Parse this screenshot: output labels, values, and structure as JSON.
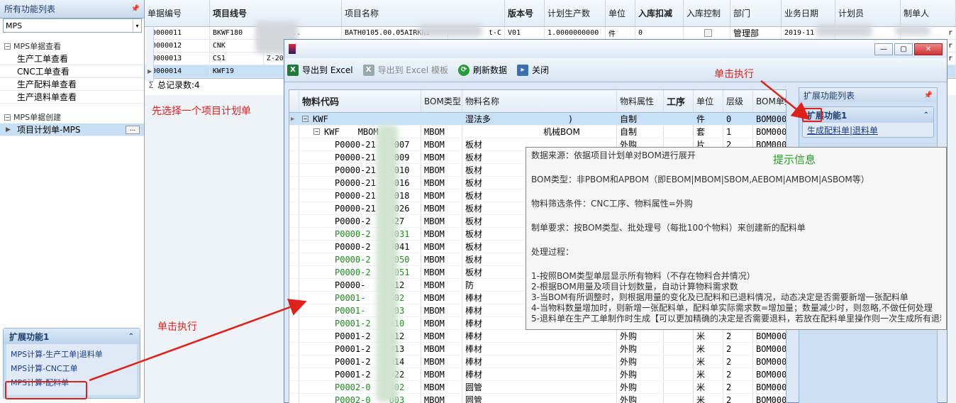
{
  "left_panel": {
    "header": "所有功能列表",
    "pin": "ᵖ",
    "combo_value": "MPS",
    "group1_title": "MPS单据查看",
    "group1_items": [
      "生产工单查看",
      "CNC工单查看",
      "生产配料单查看",
      "生产退料单查看"
    ],
    "group2_title": "MPS单据创建",
    "group2_items": [
      "项目计划单-MPS"
    ],
    "more_btn": "...",
    "ext_title": "扩展功能1",
    "ext_links": [
      "MPS计算-生产工单|退料单",
      "MPS计算-CNC工单",
      "MPS计算-配料单"
    ]
  },
  "grid": {
    "columns": [
      "单据编号",
      "项目线号",
      "项目名称",
      "版本号",
      "计划生产数",
      "单位",
      "入库扣减",
      "入库控制",
      "部门",
      "业务日期",
      "计划员",
      "制单人"
    ],
    "rows": [
      {
        "id": "00000011",
        "line": "BKWF180",
        "name_suffix": "0-05A...",
        "proj": "BATH0105.00.05AIRKNI",
        "proj2": "t-C",
        "ver": "V01",
        "qty": "1.0000000000",
        "unit": "件",
        "deduct": "0",
        "dept": "管理部",
        "date": "2019-11",
        "maker": "r"
      },
      {
        "id": "00000012",
        "line": "CNK",
        "maker": "r"
      },
      {
        "id": "00000013",
        "line": "CS1",
        "name_suffix": "Z-20",
        "maker": "r"
      },
      {
        "id": "00000014",
        "line": "KWF19"
      }
    ],
    "summary_symbol": "Σ",
    "summary": "总记录数:4"
  },
  "dialog": {
    "toolbar": {
      "export": "导出到 Excel",
      "export_template": "导出到 Excel 模板",
      "refresh": "刷新数据",
      "close": "关闭"
    },
    "tree_columns": [
      "物料代码",
      "BOM类型",
      "物料名称",
      "物料属性",
      "工序",
      "单位",
      "层级",
      "BOM单据"
    ],
    "tree_rows": [
      {
        "code": "KWF",
        "bom": "",
        "name": "湿法多",
        "name2": ")",
        "attr": "自制",
        "unit": "件",
        "level": "0",
        "doc": "BOM0000",
        "type": "root"
      },
      {
        "code": "KWF",
        "code2": "MBOM",
        "bom": "MBOM",
        "name": "",
        "name2": "机械BOM",
        "attr": "自制",
        "unit": "套",
        "level": "1",
        "doc": "BOM0000",
        "type": "sub"
      },
      {
        "code": "P0000-21",
        "code2": "007",
        "bom": "MBOM",
        "name": "板材",
        "attr": "外购",
        "unit": "片",
        "level": "2",
        "doc": "BOM000",
        "type": "leaf"
      },
      {
        "code": "P0000-21",
        "code2": "009",
        "bom": "MBOM",
        "name": "板材",
        "type": "leaf"
      },
      {
        "code": "P0000-21",
        "code2": "010",
        "bom": "MBOM",
        "name": "板材",
        "type": "leaf"
      },
      {
        "code": "P0000-21",
        "code2": "016",
        "bom": "MBOM",
        "name": "板材",
        "type": "leaf"
      },
      {
        "code": "P0000-21",
        "code2": "018",
        "bom": "MBOM",
        "name": "板材",
        "type": "leaf"
      },
      {
        "code": "P0000-21",
        "code2": "026",
        "bom": "MBOM",
        "name": "板材",
        "type": "leaf"
      },
      {
        "code": "P0000-2",
        "code2": "027",
        "bom": "MBOM",
        "name": "板材",
        "type": "leaf"
      },
      {
        "code": "P0000-2",
        "code2": "0031",
        "bom": "MBOM",
        "name": "板材",
        "type": "green"
      },
      {
        "code": "P0000-2",
        "code2": "0041",
        "bom": "MBOM",
        "name": "板材",
        "type": "leaf"
      },
      {
        "code": "P0000-2",
        "code2": "0050",
        "bom": "MBOM",
        "name": "板材",
        "type": "green"
      },
      {
        "code": "P0000-2",
        "code2": "0051",
        "bom": "MBOM",
        "name": "板材",
        "type": "green"
      },
      {
        "code": "P0000-",
        "code2": "0012",
        "bom": "MBOM",
        "name": "防",
        "type": "leaf"
      },
      {
        "code": "P0001-",
        "code2": "0002",
        "bom": "MBOM",
        "name": "棒材",
        "type": "green"
      },
      {
        "code": "P0001-",
        "code2": "0003",
        "bom": "MBOM",
        "name": "棒材",
        "type": "green"
      },
      {
        "code": "P0001-2",
        "code2": "010",
        "bom": "MBOM",
        "name": "棒材",
        "type": "green"
      },
      {
        "code": "P0001-2",
        "code2": "012",
        "bom": "MBOM",
        "name": "棒材",
        "attr": "外购",
        "unit": "米",
        "level": "2",
        "doc": "BOM0009",
        "type": "leaf"
      },
      {
        "code": "P0001-2",
        "code2": "013",
        "bom": "MBOM",
        "name": "棒材",
        "attr": "外购",
        "unit": "米",
        "level": "2",
        "doc": "BOM0009",
        "type": "leaf"
      },
      {
        "code": "P0001-2",
        "code2": "014",
        "bom": "MBOM",
        "name": "棒材",
        "attr": "外购",
        "unit": "米",
        "level": "2",
        "doc": "BOM0009",
        "type": "leaf"
      },
      {
        "code": "P0001-2",
        "code2": "022",
        "bom": "MBOM",
        "name": "棒材",
        "attr": "外购",
        "unit": "米",
        "level": "2",
        "doc": "BOM0009",
        "type": "leaf"
      },
      {
        "code": "P0002-0",
        "code2": "002",
        "bom": "MBOM",
        "name": "圆管",
        "attr": "外购",
        "unit": "米",
        "level": "2",
        "doc": "BOM0009",
        "type": "green"
      },
      {
        "code": "P0002-0",
        "code2": "003",
        "bom": "MBOM",
        "name": "圆管",
        "attr": "外购",
        "unit": "米",
        "level": "2",
        "doc": "BOM0009",
        "type": "green"
      }
    ],
    "ext_panel_title": "扩展功能列表",
    "ext_card_title": "扩展功能1",
    "ext_card_link": "生成配料单|退料单"
  },
  "tooltip": [
    "数据来源：依据项目计划单对BOM进行展开",
    "",
    "BOM类型：非PBOM和APBOM（即EBOM|MBOM|SBOM,AEBOM|AMBOM|ASBOM等）",
    "",
    "物料筛选条件：CNC工序、物料属性=外购",
    "",
    "制单要求：按BOM类型、批处理号（每批100个物料）来创建新的配料单",
    "",
    "处理过程：",
    "",
    "1-按照BOM类型单层显示所有物料（不存在物料合并情况）",
    "2-根据BOM用量及项目计划数量，自动计算物料需求数",
    "3-当BOM有所调整时，则根据用量的变化及已配料和已退料情况，动态决定是否需要新增一张配料单",
    "4-当物料数量增加时，则新增一张配料单，配料单实际需求数=增加量；数量减少时，则忽略,不做任何处理",
    "5-退料单在生产工单制作时生成【可以更加精确的决定是否需要退料，若放在配料单里操作则一次生成所有退料单"
  ],
  "annotations": {
    "select_first": "先选择一个项目计划单",
    "click_exec_left": "单击执行",
    "click_exec_top": "单击执行",
    "tip_info": "提示信息"
  }
}
